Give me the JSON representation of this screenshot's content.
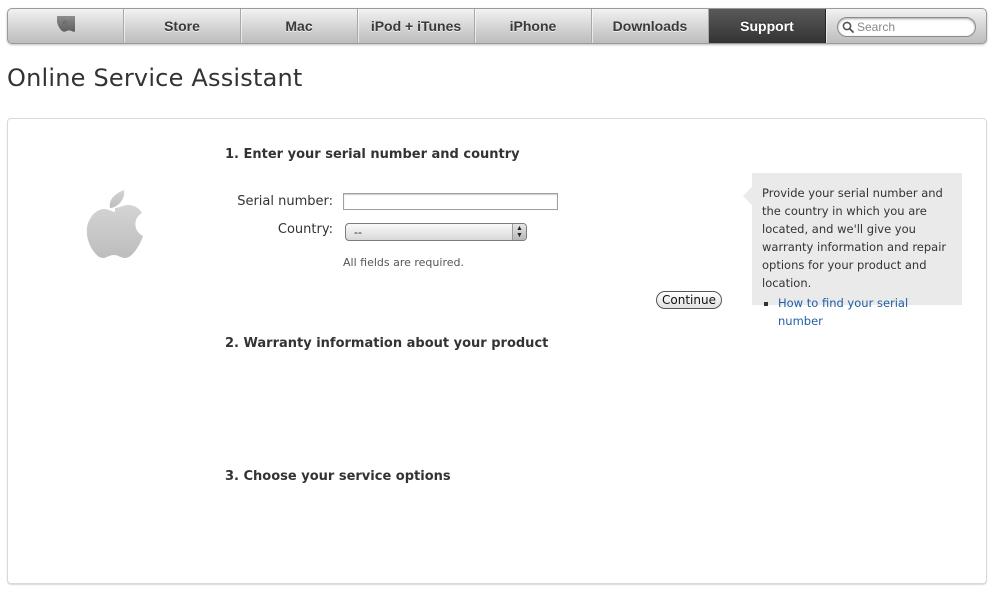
{
  "nav": {
    "items": [
      {
        "label": "Store"
      },
      {
        "label": "Mac"
      },
      {
        "label": "iPod + iTunes"
      },
      {
        "label": "iPhone"
      },
      {
        "label": "Downloads"
      },
      {
        "label": "Support"
      }
    ],
    "active": "Support",
    "search_placeholder": "Search",
    "logo_icon": "apple-logo-icon"
  },
  "page": {
    "title": "Online Service Assistant"
  },
  "steps": {
    "step1_title": "1. Enter your serial number and country",
    "step2_title": "2. Warranty information about your product",
    "step3_title": "3. Choose your service options"
  },
  "form": {
    "serial_label": "Serial number:",
    "serial_value": "",
    "country_label": "Country:",
    "country_selected": "--",
    "required_note": "All fields are required.",
    "continue_label": "Continue"
  },
  "tip": {
    "text": "Provide your serial number and the country in which you are located, and we'll give you warranty information and repair options for your product and location.",
    "link_text": "How to find your serial number"
  },
  "colors": {
    "active_tab": "#333333",
    "link": "#1f5fa8",
    "tip_background": "#eaeaea"
  }
}
